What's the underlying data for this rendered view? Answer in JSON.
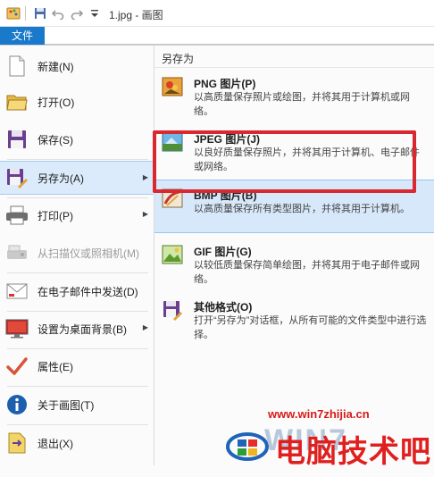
{
  "titlebar": {
    "title": "1.jpg - 画图",
    "icons": [
      "paint-app-icon",
      "save-icon",
      "undo-icon",
      "redo-icon",
      "customize-dropdown-icon"
    ]
  },
  "file_tab": {
    "label": "文件"
  },
  "left_menu": {
    "items": [
      {
        "label": "新建(N)",
        "icon": "new-file-icon"
      },
      {
        "label": "打开(O)",
        "icon": "open-folder-icon"
      },
      {
        "label": "保存(S)",
        "icon": "save-icon"
      },
      {
        "label": "另存为(A)",
        "icon": "save-as-icon",
        "active": true,
        "submenu": true
      },
      {
        "label": "打印(P)",
        "icon": "printer-icon",
        "submenu": true
      },
      {
        "label": "从扫描仪或照相机(M)",
        "icon": "scanner-icon",
        "disabled": true
      },
      {
        "label": "在电子邮件中发送(D)",
        "icon": "email-icon"
      },
      {
        "label": "设置为桌面背景(B)",
        "icon": "desktop-background-icon",
        "submenu": true
      },
      {
        "label": "属性(E)",
        "icon": "checkmark-icon"
      },
      {
        "label": "关于画图(T)",
        "icon": "info-icon"
      },
      {
        "label": "退出(X)",
        "icon": "exit-icon"
      }
    ]
  },
  "save_as_pane": {
    "title": "另存为",
    "options": [
      {
        "name": "PNG 图片(P)",
        "desc": "以高质量保存照片或绘图，并将其用于计算机或网络。",
        "icon": "png-image-icon"
      },
      {
        "name": "JPEG 图片(J)",
        "desc": "以良好质量保存照片，并将其用于计算机、电子邮件或网络。",
        "icon": "jpeg-image-icon"
      },
      {
        "name": "BMP 图片(B)",
        "desc": "以高质量保存所有类型图片，并将其用于计算机。",
        "icon": "bmp-image-icon",
        "highlighted": true
      },
      {
        "name": "GIF 图片(G)",
        "desc": "以较低质量保存简单绘图，并将其用于电子邮件或网络。",
        "icon": "gif-image-icon"
      },
      {
        "name": "其他格式(O)",
        "desc": "打开“另存为”对话框，从所有可能的文件类型中进行选择。",
        "icon": "other-formats-icon"
      }
    ]
  },
  "watermark": {
    "url": "www.win7zhijia.cn",
    "brand": "WIN7",
    "text": "电脑技术吧"
  },
  "colors": {
    "accent": "#1979ca",
    "highlight_border": "#d9282f",
    "hover_bg": "#d7e8fa"
  }
}
